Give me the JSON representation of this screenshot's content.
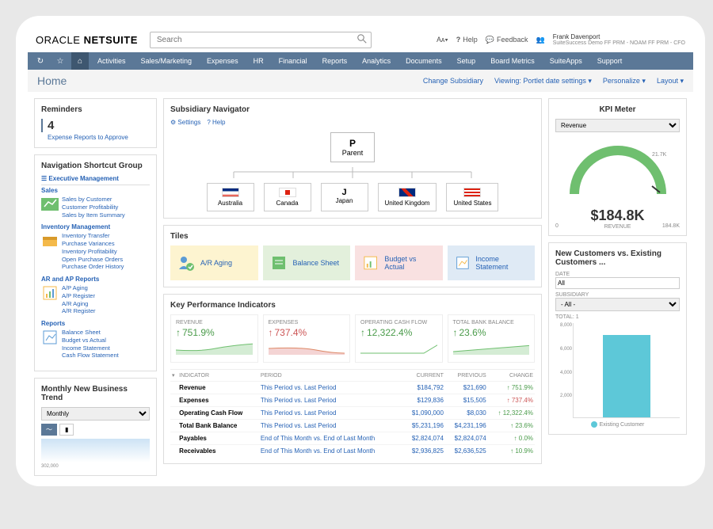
{
  "logo_a": "ORACLE",
  "logo_b": "NETSUITE",
  "search_placeholder": "Search",
  "top": {
    "help": "Help",
    "feedback": "Feedback",
    "user_name": "Frank Davenport",
    "user_sub": "SuiteSuccess Demo FF PRM - NOAM FF PRM - CFO"
  },
  "menu": [
    "Activities",
    "Sales/Marketing",
    "Expenses",
    "HR",
    "Financial",
    "Reports",
    "Analytics",
    "Documents",
    "Setup",
    "Board Metrics",
    "SuiteApps",
    "Support"
  ],
  "page_title": "Home",
  "breadcrumbs": {
    "cs": "Change Subsidiary",
    "vw": "Viewing: Portlet date settings ▾",
    "pr": "Personalize ▾",
    "ly": "Layout ▾"
  },
  "reminders": {
    "title": "Reminders",
    "count": "4",
    "link": "Expense Reports to Approve"
  },
  "nav": {
    "title": "Navigation Shortcut Group",
    "exec": "Executive Management",
    "sales": {
      "h": "Sales",
      "l": [
        "Sales by Customer",
        "Customer Profitability",
        "Sales by Item Summary"
      ]
    },
    "inv": {
      "h": "Inventory Management",
      "l": [
        "Inventory Transfer",
        "Purchase Variances",
        "Inventory Profitability",
        "Open Purchase Orders",
        "Purchase Order History"
      ]
    },
    "ar": {
      "h": "AR and AP Reports",
      "l": [
        "A/P Aging",
        "A/P Register",
        "A/R Aging",
        "A/R Register"
      ]
    },
    "rep": {
      "h": "Reports",
      "l": [
        "Balance Sheet",
        "Budget vs Actual",
        "Income Statement",
        "Cash Flow Statement"
      ]
    }
  },
  "trend": {
    "title": "Monthly New Business Trend",
    "period": "Monthly",
    "meta": "302,000"
  },
  "subs": {
    "title": "Subsidiary Navigator",
    "settings": "Settings",
    "help": "Help",
    "parent": "Parent",
    "children": [
      "Australia",
      "Canada",
      "Japan",
      "United Kingdom",
      "United States"
    ]
  },
  "tiles": {
    "title": "Tiles",
    "items": [
      "A/R Aging",
      "Balance Sheet",
      "Budget vs Actual",
      "Income Statement"
    ]
  },
  "kpi": {
    "title": "Key Performance Indicators",
    "cards": [
      {
        "l": "REVENUE",
        "v": "751.9%",
        "dir": "up",
        "color": "#8cc98c"
      },
      {
        "l": "EXPENSES",
        "v": "737.4%",
        "dir": "dn",
        "color": "#e08a8a"
      },
      {
        "l": "OPERATING CASH FLOW",
        "v": "12,322.4%",
        "dir": "up",
        "color": "#8cc98c"
      },
      {
        "l": "TOTAL BANK BALANCE",
        "v": "23.6%",
        "dir": "up",
        "color": "#8cc98c"
      }
    ],
    "th": [
      "",
      "INDICATOR",
      "PERIOD",
      "CURRENT",
      "PREVIOUS",
      "CHANGE"
    ],
    "rows": [
      {
        "i": "Revenue",
        "p": "This Period vs. Last Period",
        "c": "$184,792",
        "pr": "$21,690",
        "ch": "751.9%",
        "d": "up"
      },
      {
        "i": "Expenses",
        "p": "This Period vs. Last Period",
        "c": "$129,836",
        "pr": "$15,505",
        "ch": "737.4%",
        "d": "dn"
      },
      {
        "i": "Operating Cash Flow",
        "p": "This Period vs. Last Period",
        "c": "$1,090,000",
        "pr": "$8,030",
        "ch": "12,322.4%",
        "d": "up"
      },
      {
        "i": "Total Bank Balance",
        "p": "This Period vs. Last Period",
        "c": "$5,231,196",
        "pr": "$4,231,196",
        "ch": "23.6%",
        "d": "up"
      },
      {
        "i": "Payables",
        "p": "End of This Month vs. End of Last Month",
        "c": "$2,824,074",
        "pr": "$2,824,074",
        "ch": "0.0%",
        "d": "up"
      },
      {
        "i": "Receivables",
        "p": "End of This Month vs. End of Last Month",
        "c": "$2,936,825",
        "pr": "$2,636,525",
        "ch": "10.9%",
        "d": "up"
      }
    ]
  },
  "meter": {
    "title": "KPI Meter",
    "sel": "Revenue",
    "value": "$184.8K",
    "label": "REVENUE",
    "lo": "0",
    "hi": "184.8K",
    "tick": "21.7K"
  },
  "cust": {
    "title": "New Customers vs. Existing Customers ...",
    "date_l": "DATE",
    "date_v": "All",
    "sub_l": "SUBSIDIARY",
    "sub_v": "- All -",
    "total": "TOTAL: 1",
    "legend": "Existing Customer"
  },
  "chart_data": {
    "type": "bar",
    "categories": [
      "Existing Customer"
    ],
    "values": [
      7000
    ],
    "ylim": [
      0,
      8000
    ],
    "yticks": [
      "8,000",
      "6,000",
      "4,000",
      "2,000",
      ""
    ],
    "title": "New Customers vs. Existing Customers"
  }
}
